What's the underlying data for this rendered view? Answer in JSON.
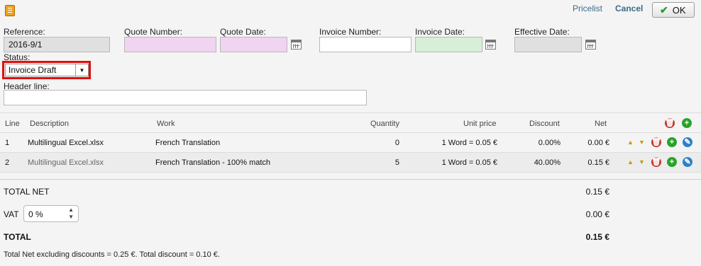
{
  "toolbar": {
    "app_icon": "spreadsheet-icon",
    "pricelist": "Pricelist",
    "cancel": "Cancel",
    "ok": "OK"
  },
  "form": {
    "reference_label": "Reference:",
    "reference_value": "2016-9/1",
    "quote_number_label": "Quote Number:",
    "quote_number_value": "",
    "quote_date_label": "Quote Date:",
    "quote_date_value": "",
    "invoice_number_label": "Invoice Number:",
    "invoice_number_value": "",
    "invoice_date_label": "Invoice Date:",
    "invoice_date_value": "",
    "effective_date_label": "Effective Date:",
    "effective_date_value": "",
    "status_label": "Status:",
    "status_value": "Invoice Draft",
    "header_line_label": "Header line:",
    "header_line_value": "",
    "highlight_color": "#e01010"
  },
  "table": {
    "headers": {
      "line": "Line",
      "description": "Description",
      "work": "Work",
      "quantity": "Quantity",
      "unit_price": "Unit price",
      "discount": "Discount",
      "net": "Net"
    },
    "rows": [
      {
        "line": "1",
        "description": "Multilingual Excel.xlsx",
        "work": "French Translation",
        "quantity": "0",
        "unit_price": "1 Word = 0.05 €",
        "discount": "0.00%",
        "net": "0.00 €"
      },
      {
        "line": "2",
        "description": "Multilingual Excel.xlsx",
        "work": "French Translation - 100% match",
        "quantity": "5",
        "unit_price": "1 Word = 0.05 €",
        "discount": "40.00%",
        "net": "0.15 €"
      }
    ]
  },
  "totals": {
    "total_net_label": "TOTAL NET",
    "total_net_value": "0.15 €",
    "vat_label": "VAT",
    "vat_value": "0 %",
    "vat_amount": "0.00 €",
    "total_label": "TOTAL",
    "total_value": "0.15 €",
    "note": "Total Net excluding discounts = 0.25 €. Total discount = 0.10 €."
  }
}
